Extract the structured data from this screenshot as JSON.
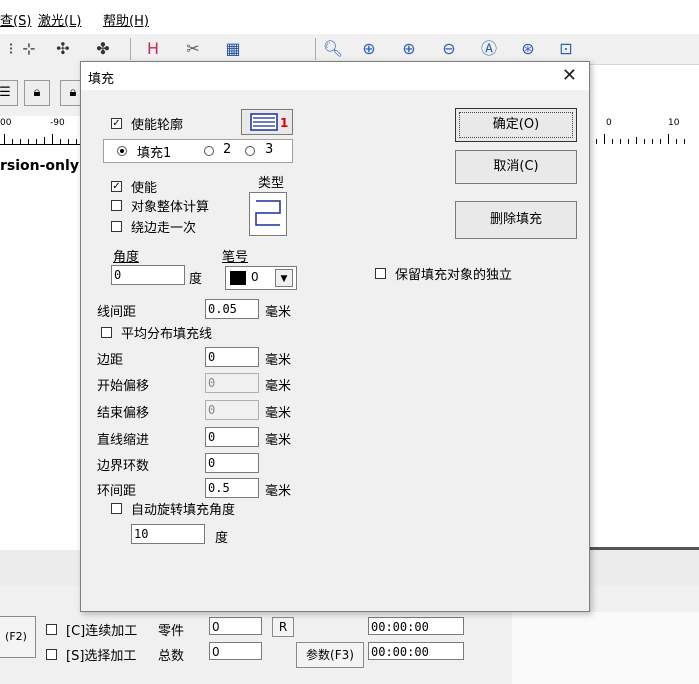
{
  "menu": {
    "items": [
      "查(S)",
      "激光(L)",
      "帮助(H)"
    ]
  },
  "toolbar": {
    "zoom_icons": [
      "zoom-icon",
      "zoom-in-icon",
      "zoom-plus-icon",
      "zoom-minus-icon",
      "zoom-a-icon",
      "zoom-fit-icon",
      "zoom-page-icon"
    ]
  },
  "ruler": {
    "left_labels": [
      "00",
      "-90"
    ],
    "right_labels": [
      "0",
      "10"
    ]
  },
  "canvas": {
    "partial_text": "rsion-only"
  },
  "dialog": {
    "title": "填充",
    "enable_outline_label": "使能轮廓",
    "enable_outline_checked": true,
    "fill_tabs": [
      "填充1",
      "2",
      "3"
    ],
    "selected_fill_tab": 0,
    "enable_label": "使能",
    "enable_checked": true,
    "object_whole_calc_label": "对象整体计算",
    "edge_once_label": "绕边走一次",
    "type_label": "类型",
    "angle_label": "角度",
    "angle_value": "0",
    "angle_unit": "度",
    "pen_label": "笔号",
    "pen_value": "0",
    "pen_color": "#000000",
    "line_spacing_label": "线间距",
    "line_spacing_value": "0.05",
    "mm_unit": "毫米",
    "avg_distribute_label": "平均分布填充线",
    "margin_label": "边距",
    "margin_value": "0",
    "start_offset_label": "开始偏移",
    "start_offset_value": "0",
    "end_offset_label": "结束偏移",
    "end_offset_value": "0",
    "line_indent_label": "直线缩进",
    "line_indent_value": "0",
    "border_loops_label": "边界环数",
    "border_loops_value": "0",
    "loop_spacing_label": "环间距",
    "loop_spacing_value": "0.5",
    "auto_rotate_label": "自动旋转填充角度",
    "rotate_value": "10",
    "rotate_unit": "度",
    "ok_button": "确定(O)",
    "cancel_button": "取消(C)",
    "delete_fill_button": "删除填充",
    "keep_independent_label": "保留填充对象的独立"
  },
  "bottom": {
    "f2_label": "(F2)",
    "continuous_label": "[C]连续加工",
    "select_label": "[S]选择加工",
    "parts_label": "零件",
    "parts_value": "0",
    "total_label": "总数",
    "total_value": "0",
    "r_button": "R",
    "params_button": "参数(F3)",
    "time1": "00:00:00",
    "time2": "00:00:00"
  }
}
